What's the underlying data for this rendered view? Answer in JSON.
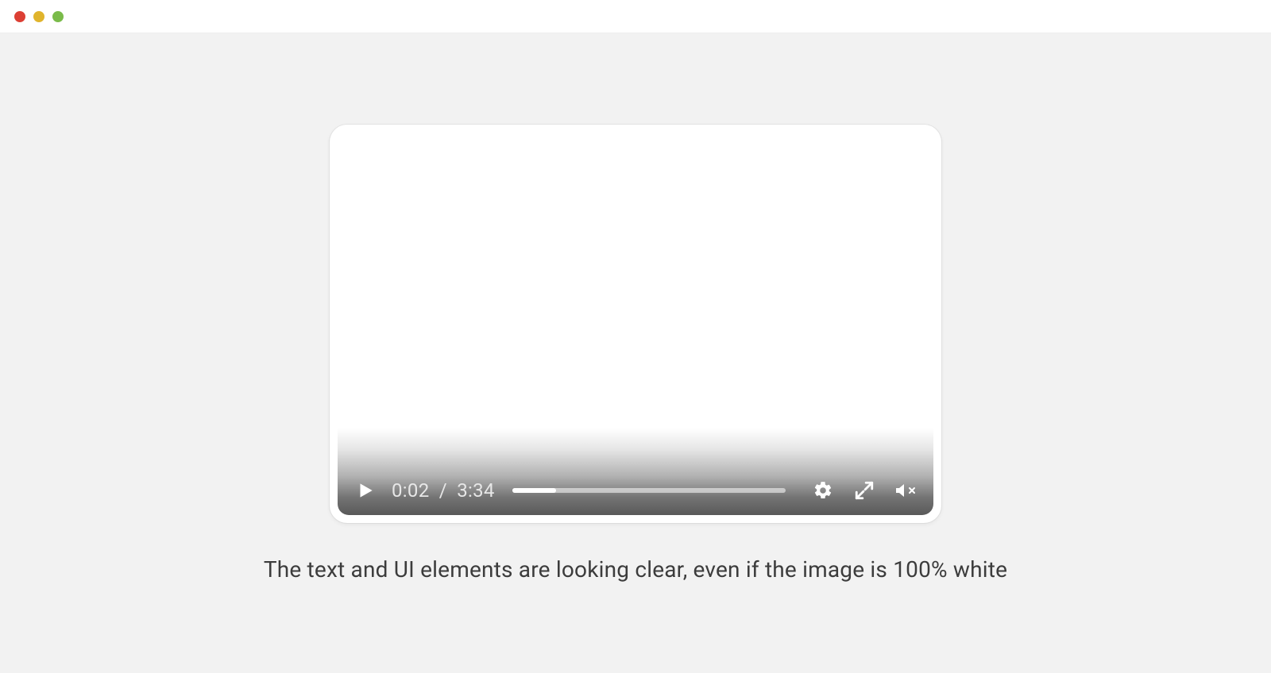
{
  "window": {
    "traffic_lights": [
      "close",
      "minimize",
      "zoom"
    ]
  },
  "player": {
    "current_time": "0:02",
    "duration": "3:34",
    "time_separator": "/",
    "progress_percent": 16,
    "icons": {
      "play": "play-icon",
      "settings": "gear-icon",
      "fullscreen": "fullscreen-icon",
      "mute": "mute-icon"
    }
  },
  "caption": "The text and UI elements are looking clear, even if the image is 100% white"
}
